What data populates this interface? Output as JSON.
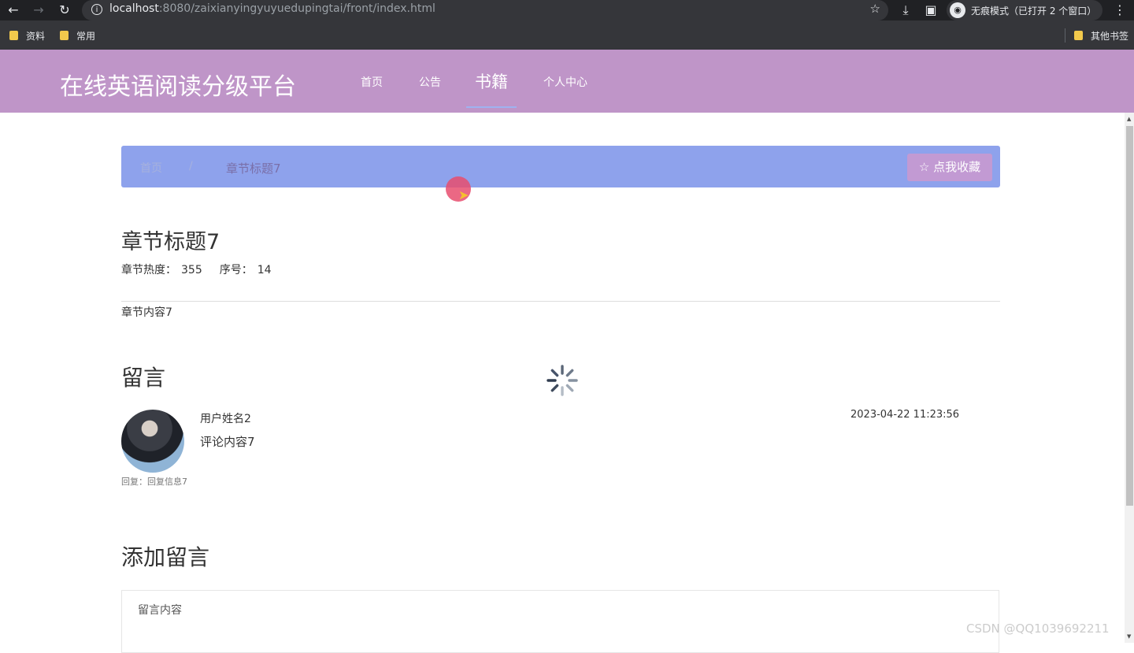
{
  "browser": {
    "url_host": "localhost",
    "url_rest": ":8080/zaixianyingyuyuedupingtai/front/index.html",
    "incognito_label": "无痕模式（已打开 2 个窗口）",
    "bookmarks": [
      "资料",
      "常用"
    ],
    "other_bookmarks": "其他书签",
    "icons": [
      "back-icon",
      "forward-icon",
      "reload-icon",
      "info-icon",
      "star-icon",
      "download-icon",
      "sidepanel-icon",
      "incognito-icon",
      "menu-icon"
    ]
  },
  "site": {
    "title": "在线英语阅读分级平台",
    "nav": [
      {
        "label": "首页"
      },
      {
        "label": "公告"
      },
      {
        "label": "书籍"
      },
      {
        "label": "个人中心"
      }
    ],
    "active_nav": "书籍",
    "colors": {
      "header": "#bf95c8",
      "breadcrumb": "#8ea2ec",
      "favorite_button": "#c29ad3"
    }
  },
  "breadcrumb": {
    "home": "首页",
    "separator": "/",
    "current": "章节标题7",
    "favorite_button": "☆ 点我收藏"
  },
  "chapter": {
    "title": "章节标题7",
    "heat_label": "章节热度：",
    "heat_value": "355",
    "order_label": "序号：",
    "order_value": "14",
    "content": "章节内容7"
  },
  "comments": {
    "heading": "留言",
    "items": [
      {
        "user": "用户姓名2",
        "text": "评论内容7",
        "time": "2023-04-22 11:23:56",
        "reply": "回复：回复信息7"
      }
    ]
  },
  "add_comment": {
    "heading": "添加留言",
    "placeholder": "留言内容"
  },
  "watermark": "CSDN @QQ1039692211"
}
